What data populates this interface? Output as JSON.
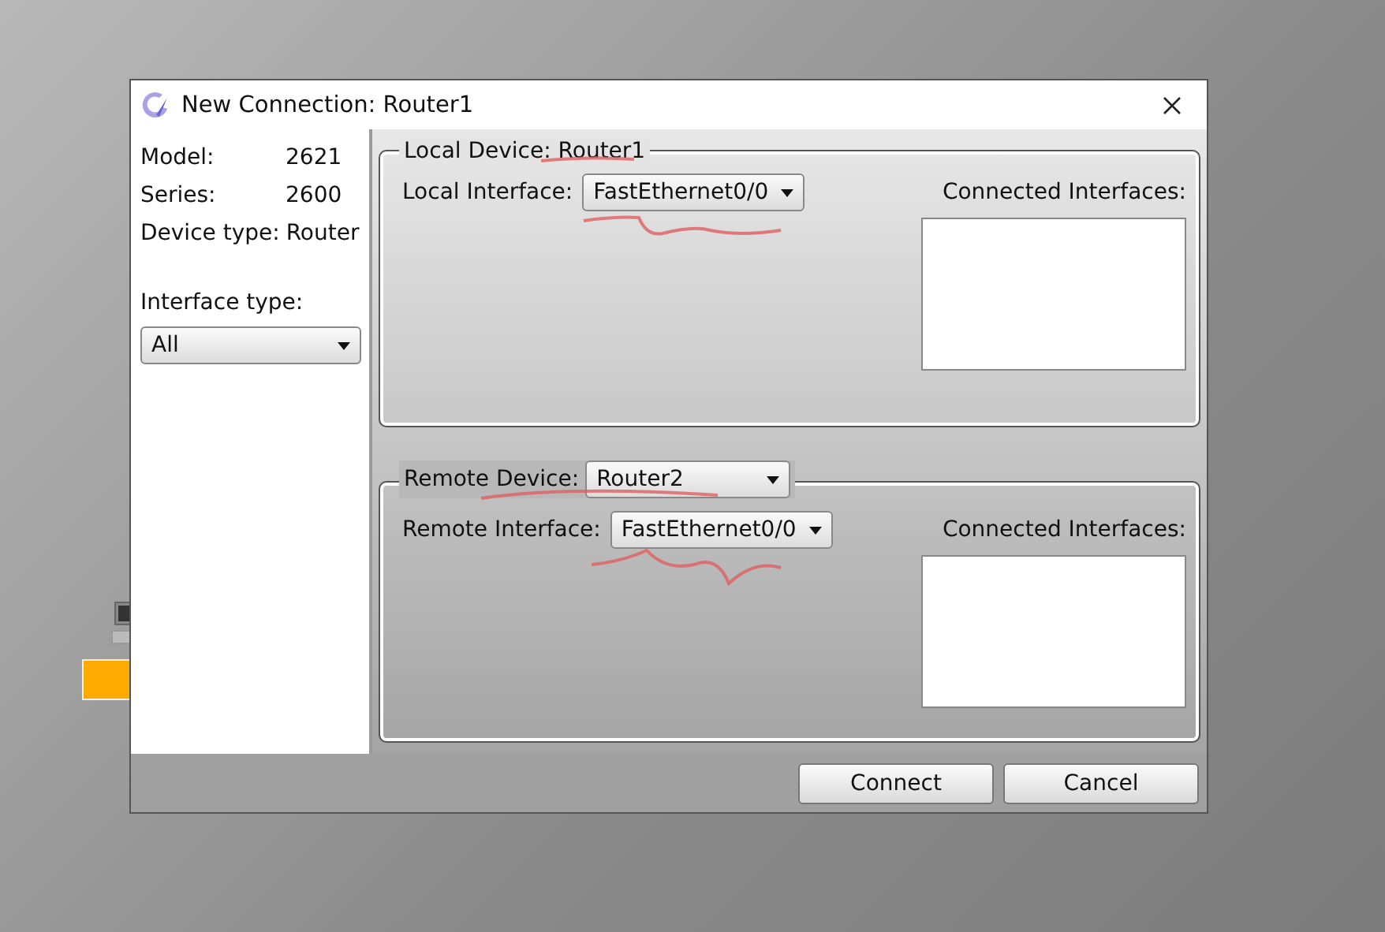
{
  "window": {
    "title": "New Connection: Router1"
  },
  "device_info": [
    {
      "label": "Model:",
      "value": "2621"
    },
    {
      "label": "Series:",
      "value": "2600"
    },
    {
      "label": "Device type:",
      "value": "Router"
    }
  ],
  "interface_type": {
    "label": "Interface type:",
    "value": "All"
  },
  "local": {
    "legend": "Local Device: Router1",
    "interface_label": "Local Interface:",
    "interface_value": "FastEthernet0/0",
    "connected_label": "Connected Interfaces:"
  },
  "remote": {
    "legend": "Remote Device:",
    "device_value": "Router2",
    "interface_label": "Remote Interface:",
    "interface_value": "FastEthernet0/0",
    "connected_label": "Connected Interfaces:"
  },
  "buttons": [
    "Connect",
    "Cancel"
  ]
}
